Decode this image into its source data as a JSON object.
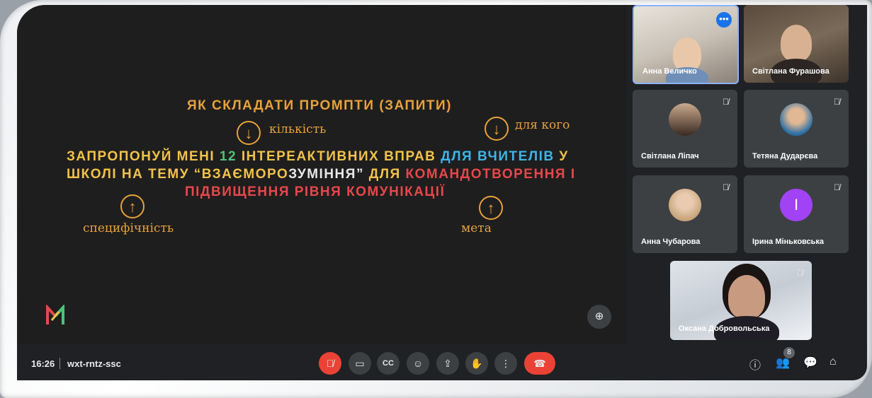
{
  "slide": {
    "title": "ЯК СКЛАДАТИ ПРОМПТИ (ЗАПИТИ)",
    "annotations": {
      "quantity": "кількість",
      "for_whom": "для кого",
      "specificity": "специфічність",
      "goal": "мета"
    },
    "prompt": {
      "l1_a": "ЗАПРОПОНУЙ МЕНІ ",
      "l1_num": "12",
      "l1_b": " ІНТЕРЕАКТИВНИХ ВПРАВ ",
      "l1_c": "ДЛЯ ВЧИТЕЛІВ",
      "l1_d": " У",
      "l2_a": "ШКОЛІ НА ТЕМУ “ВЗАЄМОРО",
      "l2_b": "ЗУМІННЯ”",
      "l2_c": "  ДЛЯ ",
      "l2_d": "КОМАНДОТВОРЕННЯ І",
      "l3": "ПІДВИЩЕННЯ РІВНЯ КОМУНІКАЦІЇ"
    }
  },
  "participants": [
    {
      "name": "Анна Величко"
    },
    {
      "name": "Світлана Фурашова"
    },
    {
      "name": "Світлана Ліпач"
    },
    {
      "name": "Тетяна Дударєва"
    },
    {
      "name": "Анна Чубарова"
    },
    {
      "name": "Ірина Міньковська",
      "initial": "І"
    },
    {
      "name": "Оксана Добровольська"
    }
  ],
  "meeting": {
    "time": "16:26",
    "code": "wxt-rntz-ssc",
    "participant_count": "8"
  },
  "colors": {
    "background": "#202124",
    "accent_orange": "#e8a23b",
    "end_call": "#ea4335",
    "avatar_purple": "#a142f4"
  }
}
